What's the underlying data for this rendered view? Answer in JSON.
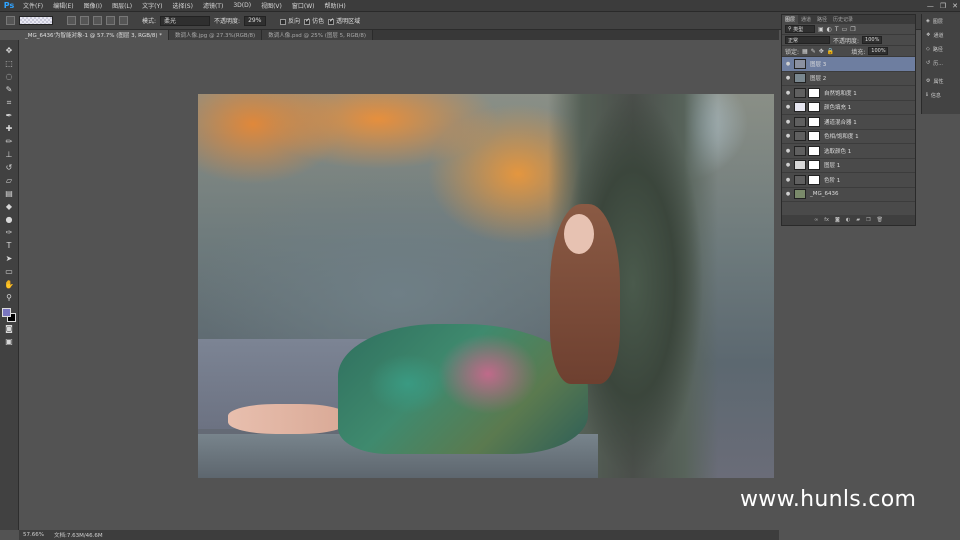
{
  "app": {
    "logo": "Ps"
  },
  "menu": [
    "文件(F)",
    "编辑(E)",
    "图像(I)",
    "图层(L)",
    "文字(Y)",
    "选择(S)",
    "滤镜(T)",
    "3D(D)",
    "视图(V)",
    "窗口(W)",
    "帮助(H)"
  ],
  "window_controls": [
    "—",
    "❐",
    "✕"
  ],
  "options": {
    "mode_label": "模式:",
    "mode_value": "柔光",
    "opacity_label": "不透明度:",
    "opacity_value": "29%",
    "reverse_label": "反向",
    "dither_label": "仿色",
    "transparency_label": "透明区域"
  },
  "tabs": [
    {
      "label": "_MG_6436'为智能对象-1 @ 57.7% (图层 3, RGB/8) *",
      "active": true
    },
    {
      "label": "数调人像.jpg @ 27.3%(RGB/8)",
      "active": false
    },
    {
      "label": "数调人像.psd @ 25% (图层 5, RGB/8)",
      "active": false
    }
  ],
  "status": {
    "zoom": "57.66%",
    "doc": "文档:7.63M/46.6M"
  },
  "watermark": "www.hunls.com",
  "layers_panel": {
    "tabs": [
      "图层",
      "通道",
      "路径",
      "历史记录"
    ],
    "kind_label": "类型",
    "blend": "正常",
    "opacity_label": "不透明度:",
    "opacity_value": "100%",
    "lock_label": "锁定:",
    "fill_label": "填充:",
    "fill_value": "100%",
    "layers": [
      {
        "name": "图层 3",
        "selected": true,
        "mask": false,
        "thumb": "#8a90a0"
      },
      {
        "name": "图层 2",
        "selected": false,
        "mask": false,
        "thumb": "#7a8890"
      },
      {
        "name": "自然饱和度 1",
        "selected": false,
        "mask": true,
        "thumb": "#606060"
      },
      {
        "name": "颜色填充 1",
        "selected": false,
        "mask": true,
        "thumb": "#e6e6f0"
      },
      {
        "name": "通道混合器 1",
        "selected": false,
        "mask": true,
        "thumb": "#606060"
      },
      {
        "name": "色相/饱和度 1",
        "selected": false,
        "mask": true,
        "thumb": "#606060"
      },
      {
        "name": "选取颜色 1",
        "selected": false,
        "mask": true,
        "thumb": "#606060"
      },
      {
        "name": "图层 1",
        "selected": false,
        "mask": true,
        "thumb": "#d8d8d8"
      },
      {
        "name": "色阶 1",
        "selected": false,
        "mask": true,
        "thumb": "#606060"
      },
      {
        "name": "_MG_6436",
        "selected": false,
        "mask": false,
        "thumb": "#7a8a6a"
      }
    ]
  },
  "dock": [
    {
      "icon": "layers-icon",
      "label": "图层"
    },
    {
      "icon": "channels-icon",
      "label": "通道"
    },
    {
      "icon": "paths-icon",
      "label": "路径"
    },
    {
      "icon": "history-icon",
      "label": "历..."
    },
    {
      "icon": "properties-icon",
      "label": "属性"
    },
    {
      "icon": "info-icon",
      "label": "信息"
    }
  ],
  "colors": {
    "foreground": "#7a76c0",
    "background": "#000000"
  }
}
